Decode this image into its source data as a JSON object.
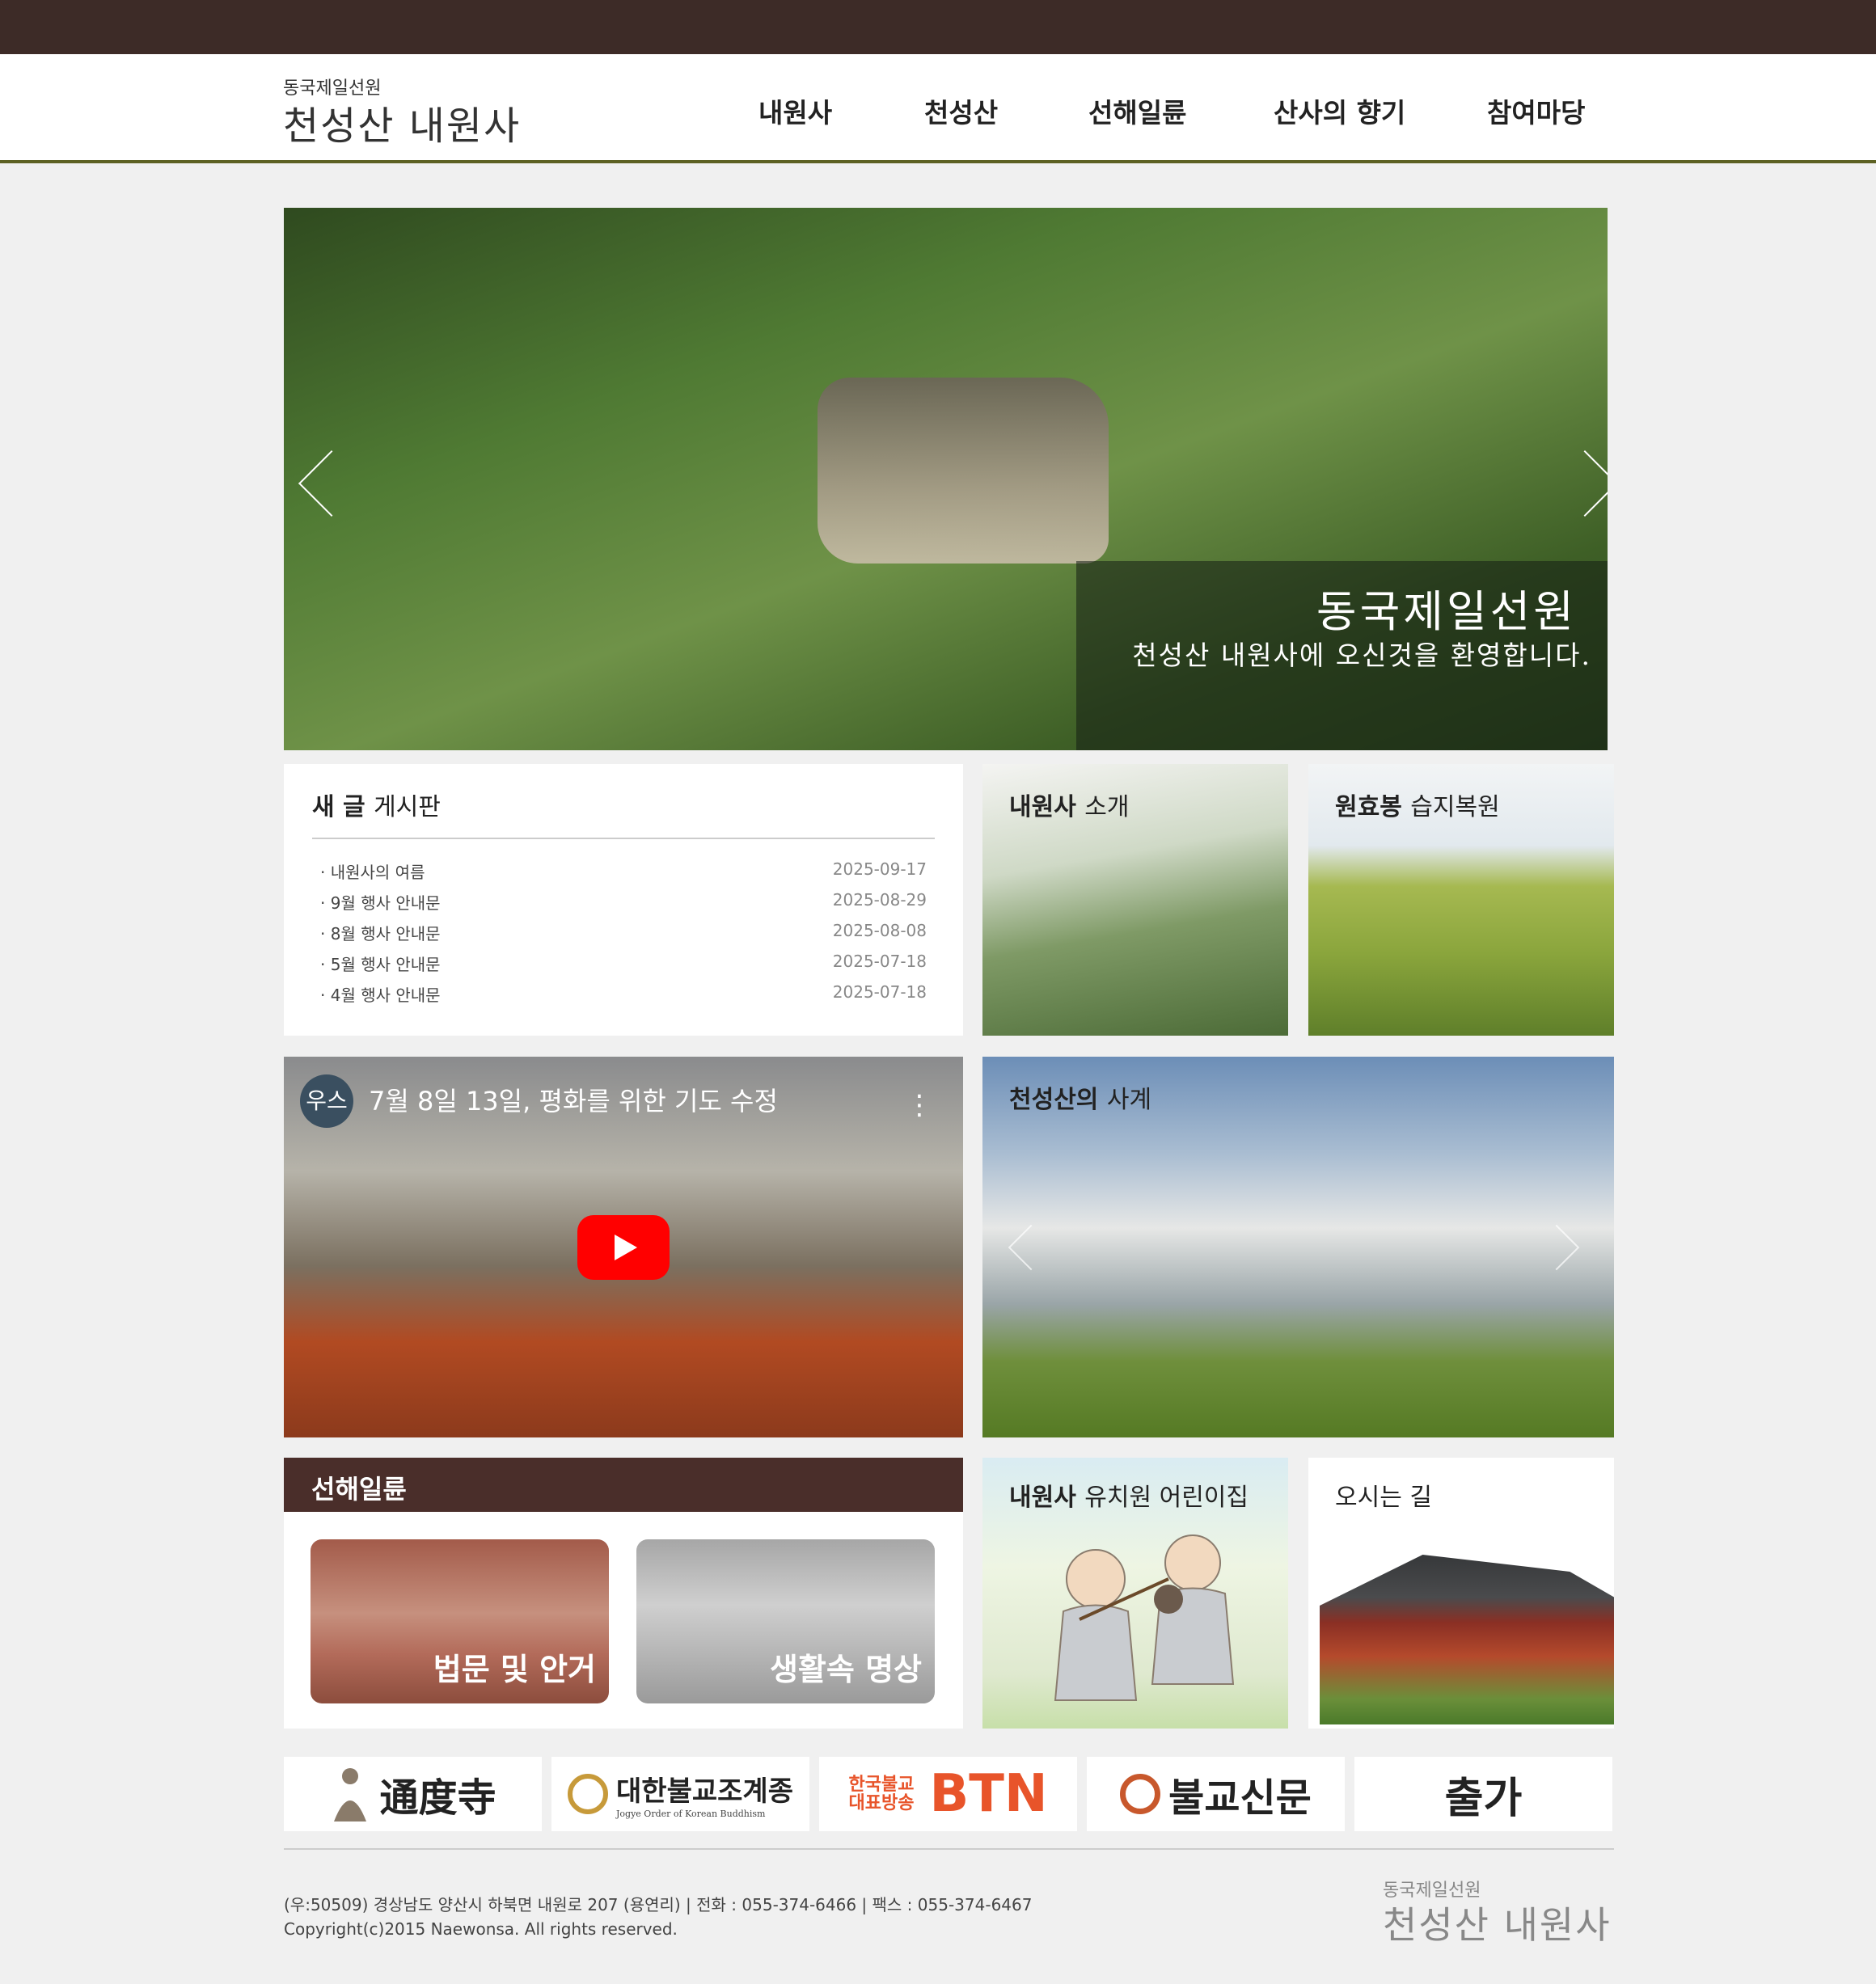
{
  "header": {
    "logo_sub": "동국제일선원",
    "logo_main": "천성산 내원사",
    "nav": [
      "내원사",
      "천성산",
      "선해일륜",
      "산사의 향기",
      "참여마당"
    ]
  },
  "hero": {
    "caption_title": "동국제일선원",
    "caption_sub": "천성산 내원사에 오신것을 환영합니다."
  },
  "board": {
    "title_bold": "새 글",
    "title_light": "게시판",
    "posts": [
      {
        "title": "· 내원사의 여름",
        "date": "2025-09-17"
      },
      {
        "title": "· 9월 행사 안내문",
        "date": "2025-08-29"
      },
      {
        "title": "· 8월 행사 안내문",
        "date": "2025-08-08"
      },
      {
        "title": "· 5월 행사 안내문",
        "date": "2025-07-18"
      },
      {
        "title": "· 4월 행사 안내문",
        "date": "2025-07-18"
      }
    ]
  },
  "cards": {
    "intro": {
      "bold": "내원사",
      "light": "소개"
    },
    "wetland": {
      "bold": "원효봉",
      "light": "습지복원"
    },
    "seasons": {
      "bold": "천성산의",
      "light": "사계"
    },
    "kindergarten": {
      "bold": "내원사",
      "light": "유치원 어린이집"
    },
    "directions": {
      "bold": "",
      "light": "오시는 길"
    }
  },
  "video": {
    "channel": "우스",
    "title": "7월 8일 13일, 평화를 위한 기도 수정",
    "more_icon": "⋮"
  },
  "meditation": {
    "heading": "선해일륜",
    "items": [
      "법문 및 안거",
      "생활속 명상"
    ]
  },
  "partners": [
    {
      "name": "通度寺",
      "icon": "buddha-icon",
      "color": "#8a7b6a"
    },
    {
      "name": "대한불교조계종",
      "sub": "Jogye Order of Korean Buddhism",
      "icon": "jogye-emblem-icon",
      "color": "#c79a3a"
    },
    {
      "name": "BTN",
      "sub": "한국불교 대표방송",
      "icon": "btn-logo",
      "color": "#e8542a"
    },
    {
      "name": "불교신문",
      "icon": "bulgyo-emblem-icon",
      "color": "#c8582c"
    },
    {
      "name": "출가",
      "icon": "chulga-calligraphy",
      "color": "#222222"
    }
  ],
  "footer": {
    "address": "(우:50509) 경상남도 양산시 하북면 내원로 207 (용연리)   |   전화 : 055-374-6466   |   팩스 : 055-374-6467",
    "copyright": "Copyright(c)2015 Naewonsa. All rights reserved.",
    "logo_sub": "동국제일선원",
    "logo_main": "천성산 내원사"
  }
}
